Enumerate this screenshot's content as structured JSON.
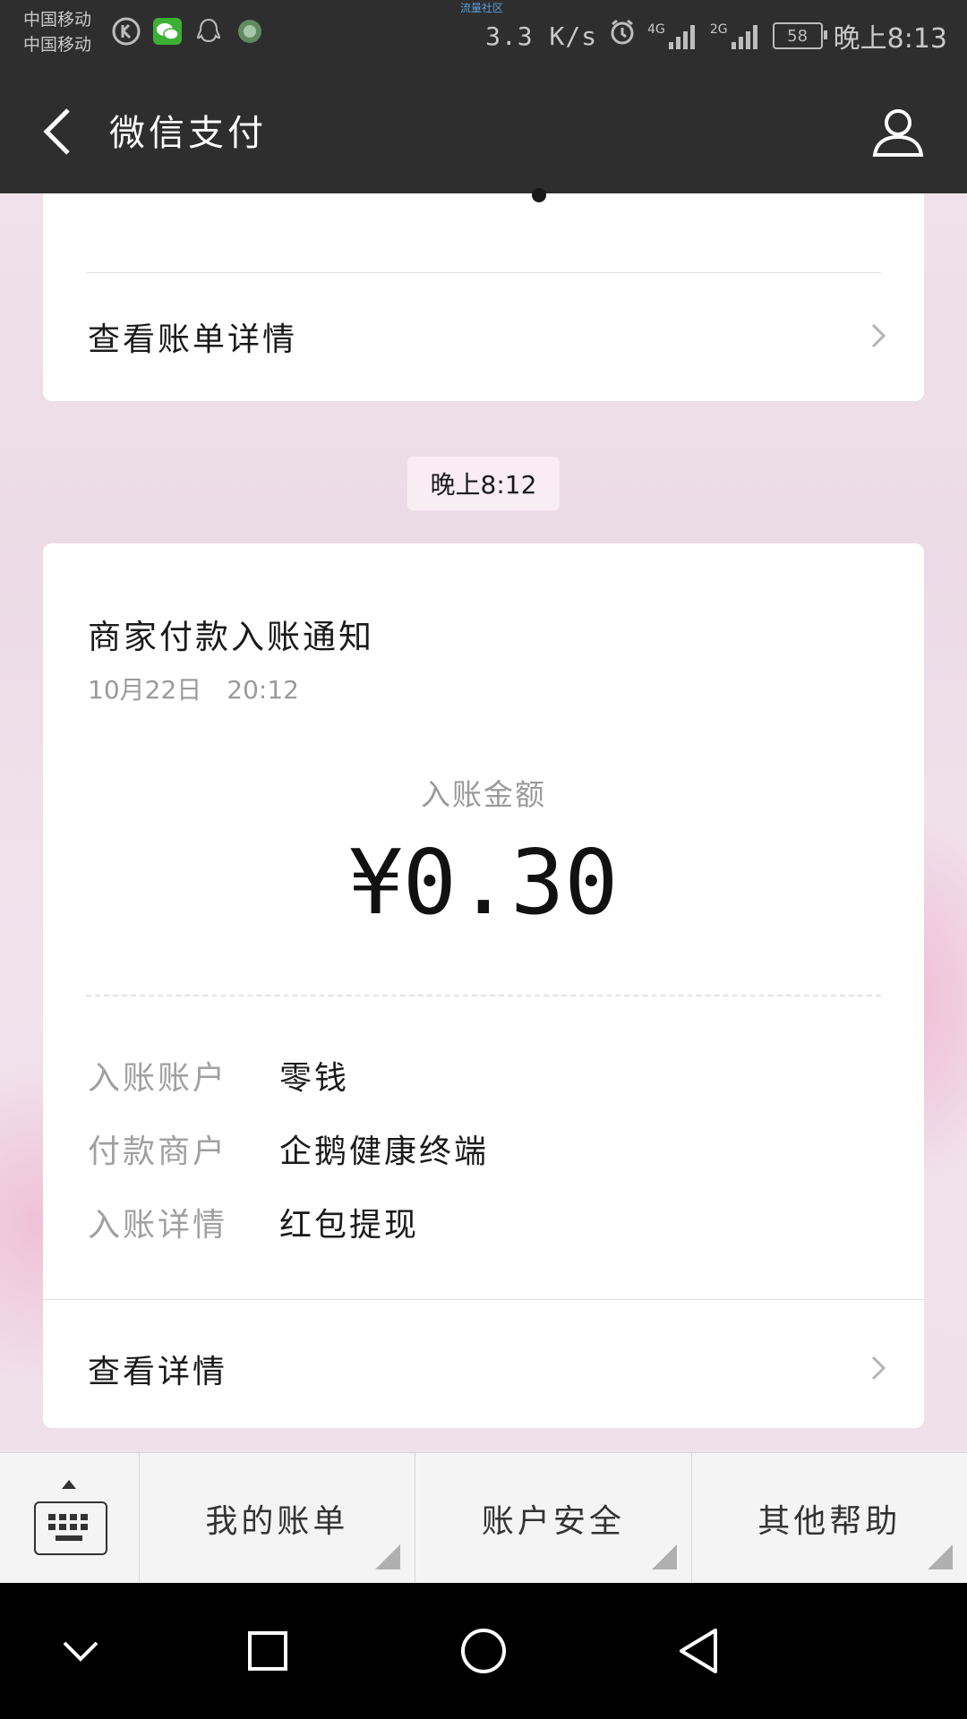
{
  "status_bar": {
    "carrier_1": "中国移动",
    "carrier_2": "中国移动",
    "net_tag": "流量社区",
    "speed": "3.3 K/s",
    "signal_1": "4G",
    "signal_2": "2G",
    "battery": "58",
    "time": "晚上8:13",
    "icons": [
      "k-app-icon",
      "wechat-icon",
      "qq-icon",
      "app-icon",
      "alarm-icon",
      "signal-icon",
      "signal-icon",
      "battery-icon"
    ]
  },
  "nav": {
    "title": "微信支付",
    "back_icon": "chevron-left-icon",
    "profile_icon": "user-icon"
  },
  "top_card": {
    "link_label": "查看账单详情"
  },
  "time_chip": "晚上8:12",
  "notice": {
    "title": "商家付款入账通知",
    "date": "10月22日　20:12",
    "amount_label": "入账金额",
    "amount": "¥0.30",
    "details": [
      {
        "key": "入账账户",
        "value": "零钱"
      },
      {
        "key": "付款商户",
        "value": "企鹅健康终端"
      },
      {
        "key": "入账详情",
        "value": "红包提现"
      }
    ],
    "link_label": "查看详情"
  },
  "menu": {
    "keyboard_icon": "keyboard-icon",
    "items": [
      "我的账单",
      "账户安全",
      "其他帮助"
    ]
  },
  "system_nav": [
    "chevron-down-icon",
    "square-icon",
    "circle-icon",
    "triangle-back-icon"
  ],
  "colors": {
    "nav_bg": "#2e2e2e",
    "card_bg": "#ffffff",
    "system_nav_bg": "#000000"
  }
}
